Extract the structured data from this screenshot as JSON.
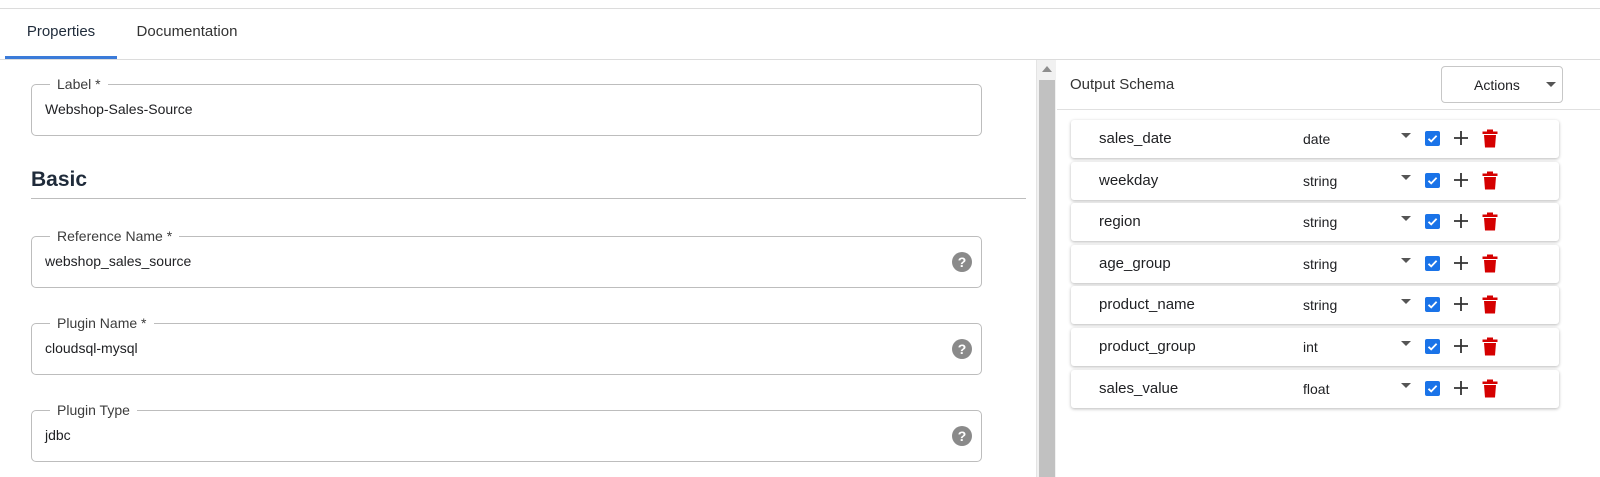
{
  "tabs": [
    {
      "label": "Properties",
      "active": true
    },
    {
      "label": "Documentation",
      "active": false
    }
  ],
  "form": {
    "label_field": {
      "legend": "Label *",
      "value": "Webshop-Sales-Source"
    },
    "section_title": "Basic",
    "reference_name": {
      "legend": "Reference Name *",
      "value": "webshop_sales_source"
    },
    "plugin_name": {
      "legend": "Plugin Name *",
      "value": "cloudsql-mysql"
    },
    "plugin_type": {
      "legend": "Plugin Type",
      "value": "jdbc"
    },
    "help_glyph": "?"
  },
  "schema": {
    "title": "Output Schema",
    "actions_label": "Actions",
    "rows": [
      {
        "name": "sales_date",
        "type": "date",
        "nullable": true
      },
      {
        "name": "weekday",
        "type": "string",
        "nullable": true
      },
      {
        "name": "region",
        "type": "string",
        "nullable": true
      },
      {
        "name": "age_group",
        "type": "string",
        "nullable": true
      },
      {
        "name": "product_name",
        "type": "string",
        "nullable": true
      },
      {
        "name": "product_group",
        "type": "int",
        "nullable": true
      },
      {
        "name": "sales_value",
        "type": "float",
        "nullable": true
      }
    ]
  },
  "colors": {
    "tab_accent": "#3b7bd9",
    "checkbox": "#1a73e8",
    "delete": "#d50000"
  },
  "icons": {
    "help": "help-circle-icon",
    "add": "plus-icon",
    "delete": "trash-icon",
    "dropdown": "caret-down-icon",
    "checkbox": "checkbox-checked-icon"
  }
}
